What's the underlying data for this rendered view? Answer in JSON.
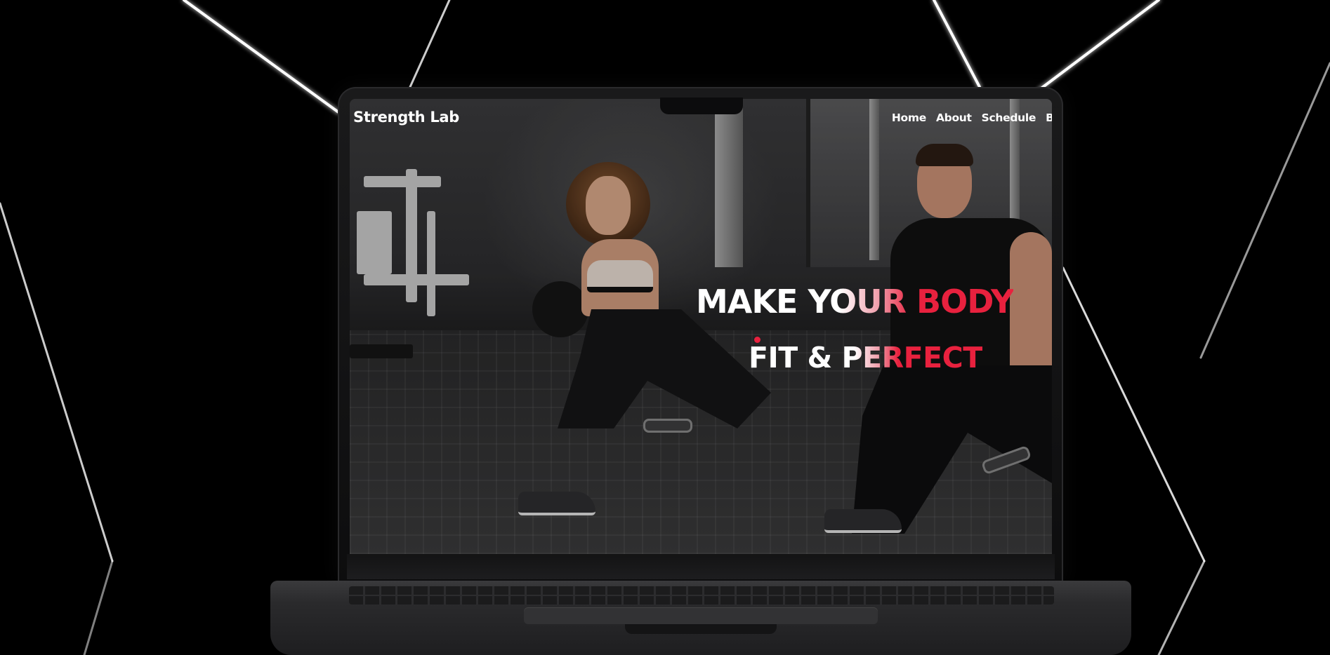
{
  "site": {
    "brand": "Strength Lab",
    "nav": [
      "Home",
      "About",
      "Schedule",
      "Blo"
    ]
  },
  "hero": {
    "headline_line1": "MAKE YOUR BODY",
    "headline_line2": "FIT & PERFECT",
    "accent_color": "#e8213e"
  },
  "device": {
    "type": "laptop-mockup"
  }
}
